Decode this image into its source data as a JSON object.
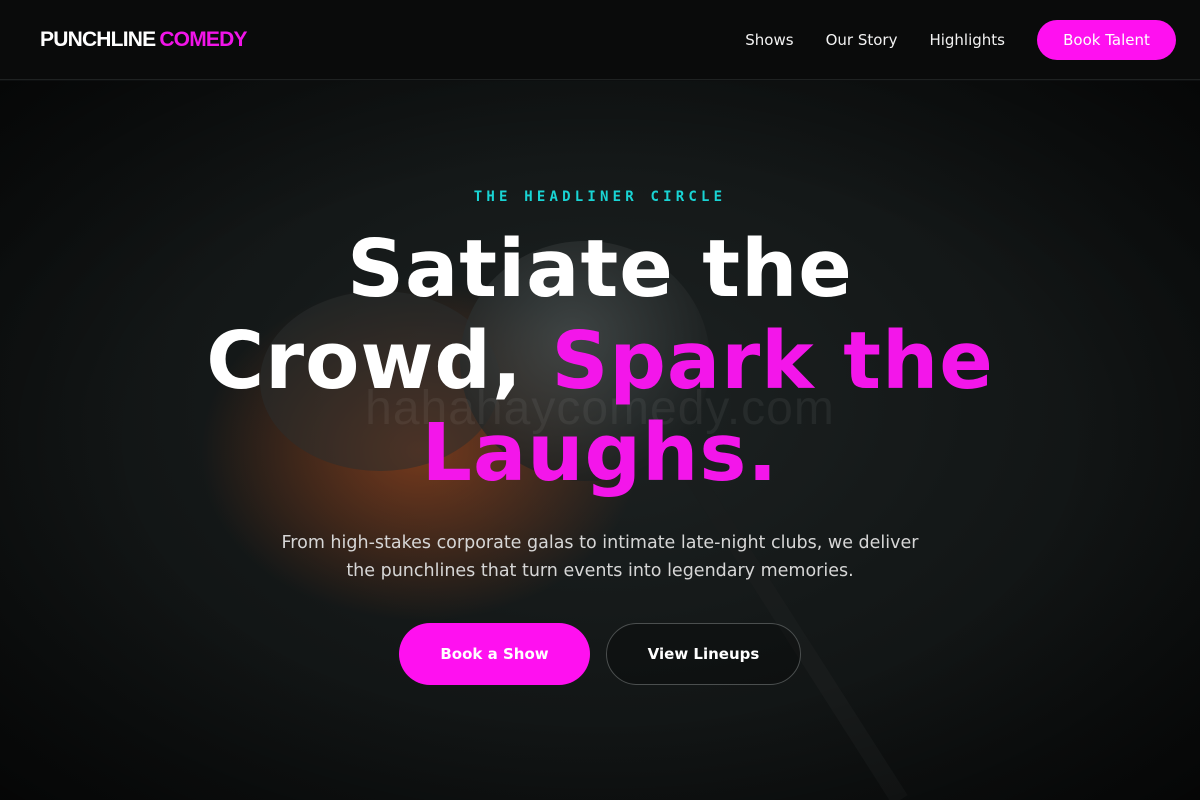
{
  "brand": {
    "word1": "PUNCHLINE",
    "word2": "COMEDY",
    "accent": "#ff10f0"
  },
  "nav": {
    "links": [
      {
        "label": "Shows"
      },
      {
        "label": "Our Story"
      },
      {
        "label": "Highlights"
      }
    ],
    "cta_label": "Book Talent"
  },
  "hero": {
    "eyebrow": "THE HEADLINER CIRCLE",
    "headline": {
      "line1": "Satiate the",
      "line2_white": "Crowd, ",
      "line2_pink": "Spark the",
      "line3": "Laughs."
    },
    "subtext": "From high-stakes corporate galas to intimate late-night clubs, we deliver the punchlines that turn events into legendary memories.",
    "primary_button": "Book a Show",
    "secondary_button": "View Lineups",
    "watermark": "hahahaycomedy.com",
    "background_image": "microphone-photo",
    "colors": {
      "eyebrow": "#19d4d4",
      "pink": "#f316ea"
    }
  }
}
